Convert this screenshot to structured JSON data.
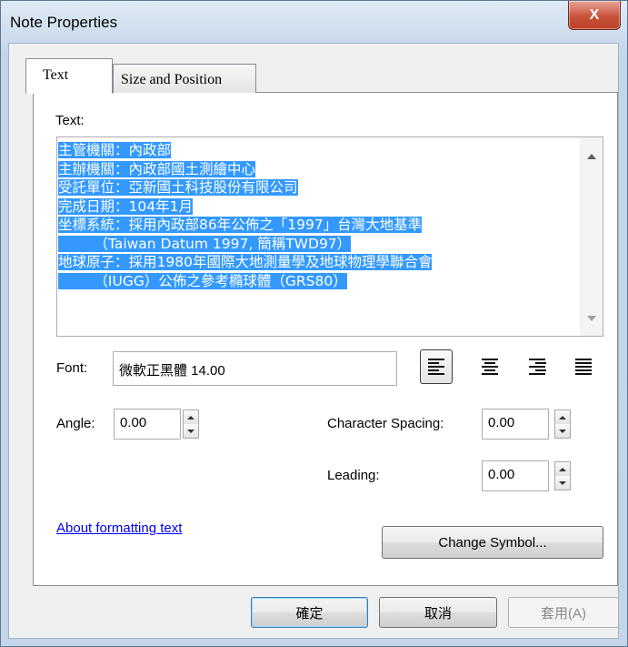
{
  "window": {
    "title": "Note Properties",
    "close_glyph": "X"
  },
  "tabs": [
    {
      "label": "Text",
      "active": true
    },
    {
      "label": "Size and Position",
      "active": false
    }
  ],
  "text_section": {
    "label": "Text:",
    "lines": [
      "主管機關：內政部",
      "主辦機關：內政部國土測繪中心",
      "受託單位：亞新國土科技股份有限公司",
      "完成日期：104年1月",
      "坐標系統：採用內政部86年公佈之「1997」台灣大地基準",
      "        （Taiwan Datum 1997, 簡稱TWD97）",
      "地球原子：採用1980年國際大地測量學及地球物理學聯合會",
      "        （IUGG）公佈之參考橢球體（GRS80）"
    ]
  },
  "font": {
    "label": "Font:",
    "value": "微軟正黑體 14.00"
  },
  "alignment": {
    "options": [
      "align-left",
      "align-center",
      "align-right",
      "justify"
    ],
    "selected": "align-left"
  },
  "angle": {
    "label": "Angle:",
    "value": "0.00"
  },
  "character_spacing": {
    "label": "Character Spacing:",
    "value": "0.00"
  },
  "leading": {
    "label": "Leading:",
    "value": "0.00"
  },
  "link": {
    "label": "About formatting text"
  },
  "change_symbol": {
    "label": "Change Symbol..."
  },
  "buttons": {
    "ok": "確定",
    "cancel": "取消",
    "apply": "套用(A)"
  }
}
